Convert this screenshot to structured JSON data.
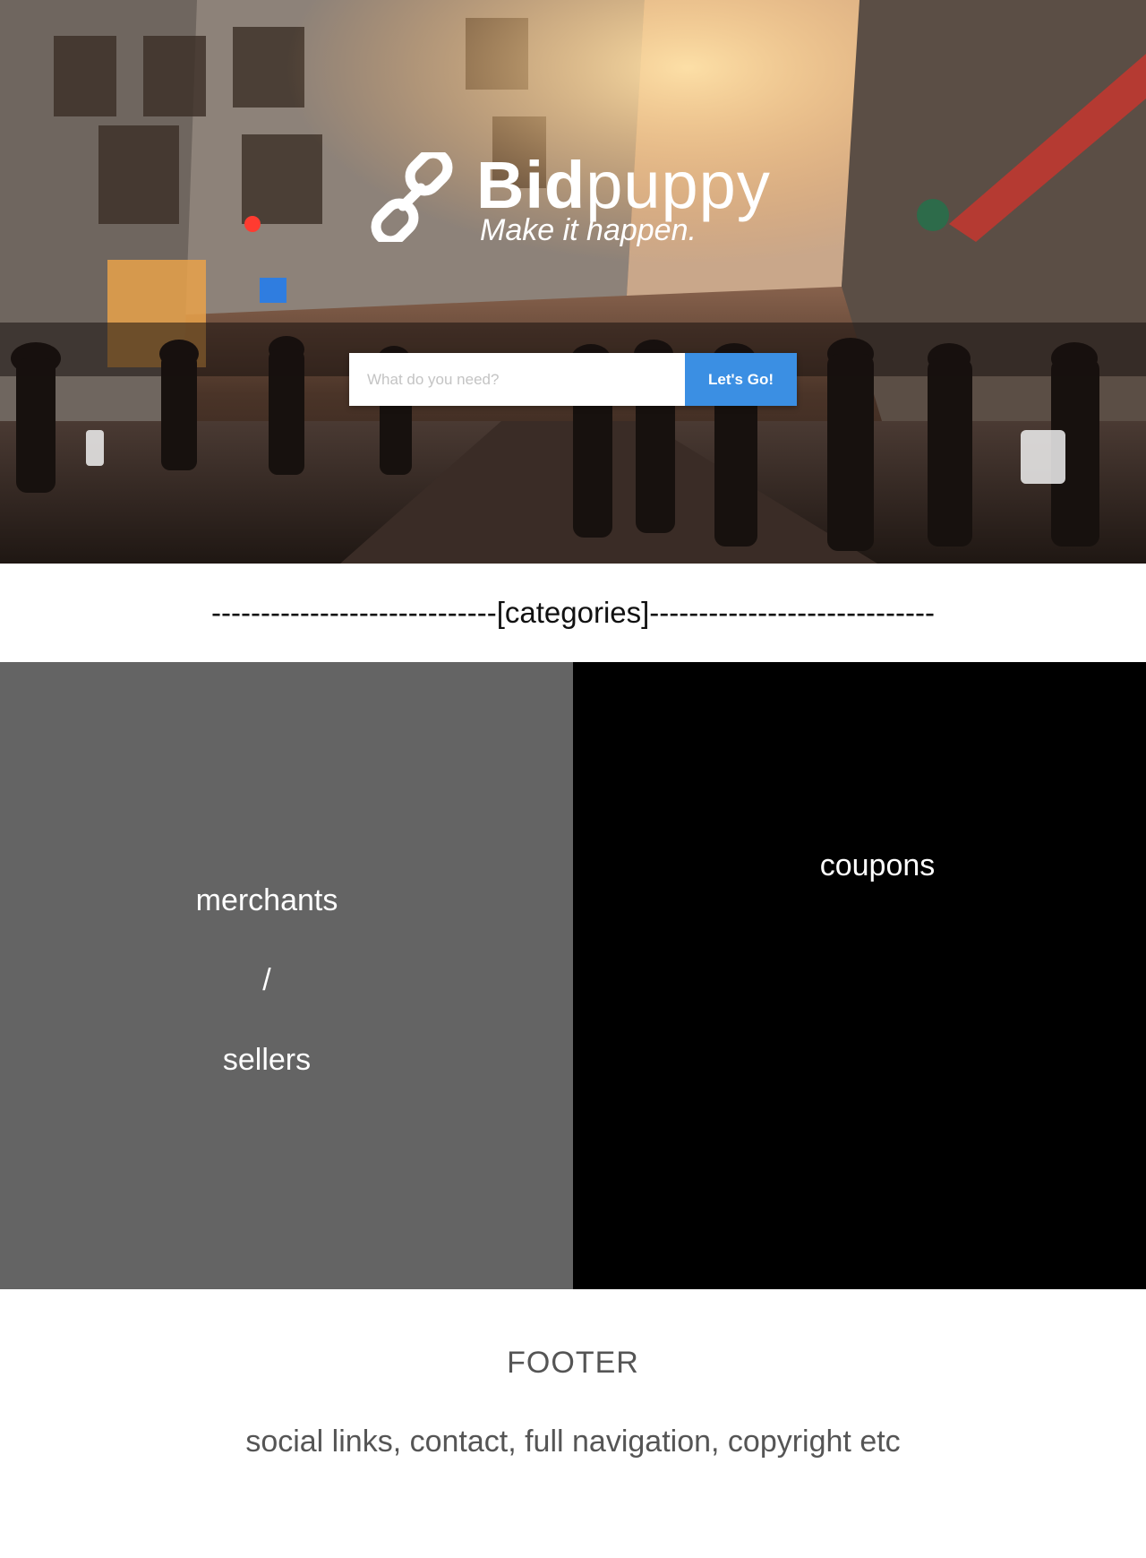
{
  "hero": {
    "brand_bold": "Bid",
    "brand_light": "puppy",
    "tagline": "Make it happen.",
    "logo_icon": "chain-link-icon"
  },
  "search": {
    "placeholder": "What do you need?",
    "button_label": "Let's Go!",
    "button_color": "#3b8fe3"
  },
  "categories": {
    "heading": "-----------------------------[categories]-----------------------------"
  },
  "tiles": {
    "merchants": {
      "line1": "merchants",
      "line2": "/",
      "line3": "sellers",
      "background": "#646464"
    },
    "coupons": {
      "label": "coupons",
      "background": "#000000"
    }
  },
  "footer": {
    "title": "FOOTER",
    "text": "social links, contact, full navigation, copyright etc"
  }
}
